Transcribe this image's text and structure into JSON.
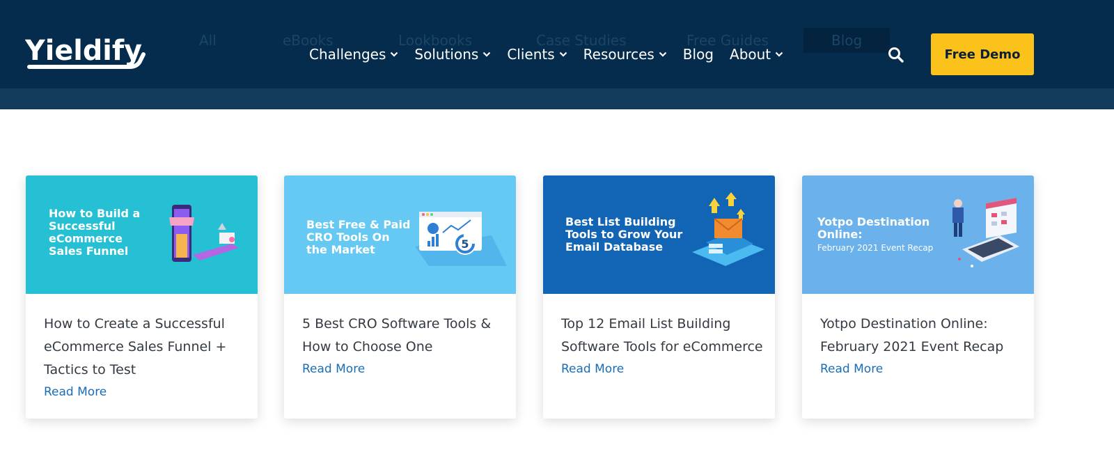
{
  "brand": {
    "logo_text": "Yieldify",
    "accent": "#fbc21b",
    "header_bg": "#052c4c"
  },
  "ghost_tabs": [
    "All",
    "eBooks",
    "Lookbooks",
    "Case Studies",
    "Free Guides",
    "Blog"
  ],
  "nav": {
    "items": [
      {
        "label": "Challenges",
        "has_dropdown": true
      },
      {
        "label": "Solutions",
        "has_dropdown": true
      },
      {
        "label": "Clients",
        "has_dropdown": true
      },
      {
        "label": "Resources",
        "has_dropdown": true
      },
      {
        "label": "Blog",
        "has_dropdown": false
      },
      {
        "label": "About",
        "has_dropdown": true
      }
    ],
    "search_icon": "search-icon",
    "cta_label": "Free Demo"
  },
  "cards": [
    {
      "hero_bg": "#25c0d3",
      "hero_text": "How to Build a\nSuccessful\neCommerce\nSales Funnel",
      "title": "How to Create a Successful eCommerce Sales Funnel + Tactics to Test",
      "link": "Read More"
    },
    {
      "hero_bg": "#65c9f3",
      "hero_text": "Best Free & Paid\nCRO Tools On\nthe Market",
      "hero_badge": "5",
      "title": "5 Best CRO Software Tools & How to Choose One",
      "link": "Read More"
    },
    {
      "hero_bg": "#1265b5",
      "hero_text": "Best List Building\nTools to Grow Your\nEmail Database",
      "title": "Top 12 Email List Building Software Tools for eCommerce",
      "link": "Read More"
    },
    {
      "hero_bg": "#6bb2ec",
      "hero_text": "Yotpo Destination\nOnline:",
      "hero_sub": "February 2021 Event Recap",
      "title": "Yotpo Destination Online: February 2021 Event Recap",
      "link": "Read More"
    }
  ]
}
